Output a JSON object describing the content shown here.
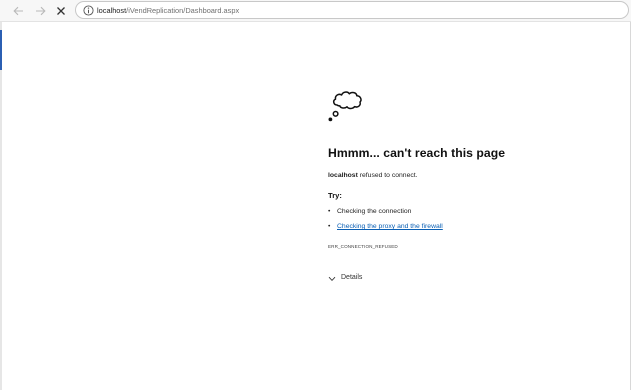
{
  "browser": {
    "back_icon": "arrow-left-icon",
    "forward_icon": "arrow-right-icon",
    "stop_icon": "close-icon",
    "site_info_icon": "info-circle-icon",
    "address": {
      "host": "localhost",
      "path": "/iVendReplication/Dashboard.aspx"
    }
  },
  "error_page": {
    "illustration_icon": "thought-cloud-icon",
    "title": "Hmmm... can't reach this page",
    "description_host": "localhost",
    "description_text": " refused to connect.",
    "try_label": "Try:",
    "suggestions": [
      {
        "bullet": "•",
        "text": "Checking the connection"
      },
      {
        "bullet": "•",
        "text": "Checking the proxy and the firewall"
      }
    ],
    "error_code": "ERR_CONNECTION_REFUSED",
    "details_label": "Details",
    "link_color": "#0a5fb4"
  }
}
